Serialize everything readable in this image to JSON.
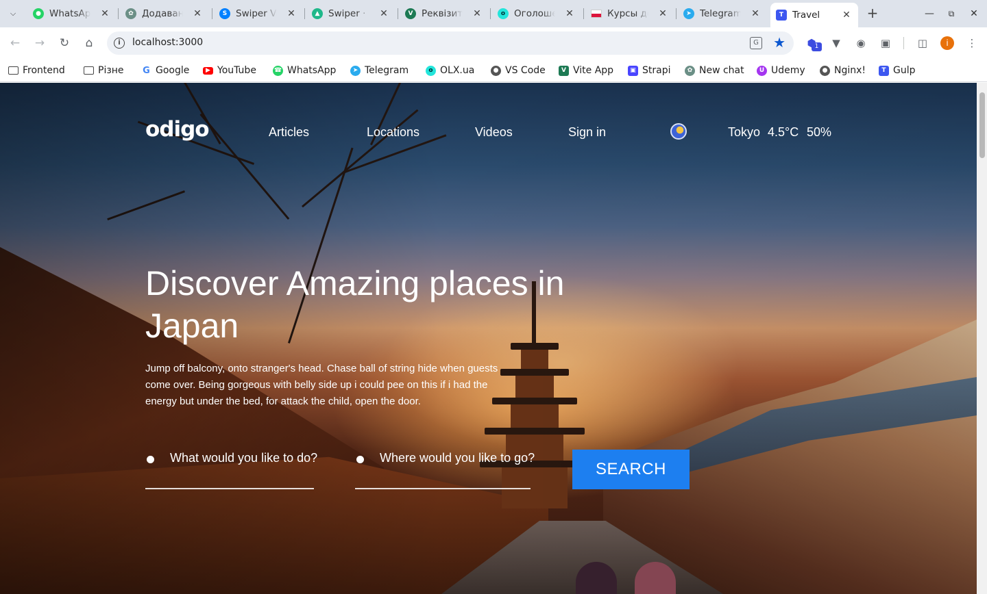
{
  "browser": {
    "tabs": [
      {
        "label": "WhatsApp",
        "icon": "whatsapp-icon",
        "color": "#25d366"
      },
      {
        "label": "Додаванн",
        "icon": "chatgpt-icon",
        "color": "#6b8f86"
      },
      {
        "label": "Swiper Vu",
        "icon": "swiper-icon",
        "color": "#0080ff"
      },
      {
        "label": "Swiper · N",
        "icon": "swiper-demo-icon",
        "color": "#1fb88a"
      },
      {
        "label": "Реквізити",
        "icon": "vite-icon",
        "color": "#1d7a54"
      },
      {
        "label": "Оголоше",
        "icon": "olx-icon",
        "color": "#23e5db"
      },
      {
        "label": "Курсы до",
        "icon": "poland-flag-icon",
        "color": "#dc143c"
      },
      {
        "label": "Telegram",
        "icon": "telegram-icon",
        "color": "#2aabee"
      },
      {
        "label": "Travel",
        "icon": "travel-icon",
        "color": "#3d57f0",
        "active": true
      }
    ],
    "address": "localhost:3000",
    "profile_initial": "i",
    "extension_badge": "1",
    "bookmarks": [
      {
        "label": "Frontend",
        "icon": "folder-icon"
      },
      {
        "label": "Різне",
        "icon": "folder-icon"
      },
      {
        "label": "Google",
        "icon": "google-icon",
        "color": "#4285f4"
      },
      {
        "label": "YouTube",
        "icon": "youtube-icon",
        "color": "#ff0000"
      },
      {
        "label": "WhatsApp",
        "icon": "whatsapp-icon",
        "color": "#25d366"
      },
      {
        "label": "Telegram",
        "icon": "telegram-icon",
        "color": "#2aabee"
      },
      {
        "label": "OLX.ua",
        "icon": "olx-icon",
        "color": "#23e5db"
      },
      {
        "label": "VS Code",
        "icon": "globe-icon",
        "color": "#555555"
      },
      {
        "label": "Vite App",
        "icon": "vite-icon",
        "color": "#1d7a54"
      },
      {
        "label": "Strapi",
        "icon": "strapi-icon",
        "color": "#4945ff"
      },
      {
        "label": "New chat",
        "icon": "chatgpt-icon",
        "color": "#6b8f86"
      },
      {
        "label": "Udemy",
        "icon": "udemy-icon",
        "color": "#a435f0"
      },
      {
        "label": "Nginx!",
        "icon": "globe-icon",
        "color": "#555555"
      },
      {
        "label": "Gulp",
        "icon": "gulp-icon",
        "color": "#3d57f0"
      }
    ]
  },
  "site": {
    "logo": "odigo",
    "nav": [
      "Articles",
      "Locations",
      "Videos",
      "Sign in"
    ],
    "weather": {
      "city": "Tokyo",
      "temperature": "4.5°C",
      "humidity": "50%",
      "icon": "weather-icon"
    },
    "hero": {
      "title": "Discover Amazing places in Japan",
      "text": "Jump off balcony, onto stranger's head. Chase ball of string hide when guests come over. Being gorgeous with belly side up i could pee on this if i had the energy but under the bed, for attack the child, open the door."
    },
    "search": {
      "activity_placeholder": "What would you like to do?",
      "destination_placeholder": "Where would you like to go?",
      "button_label": "SEARCH"
    },
    "colors": {
      "accent": "#1d7ff0",
      "text": "#ffffff"
    }
  }
}
